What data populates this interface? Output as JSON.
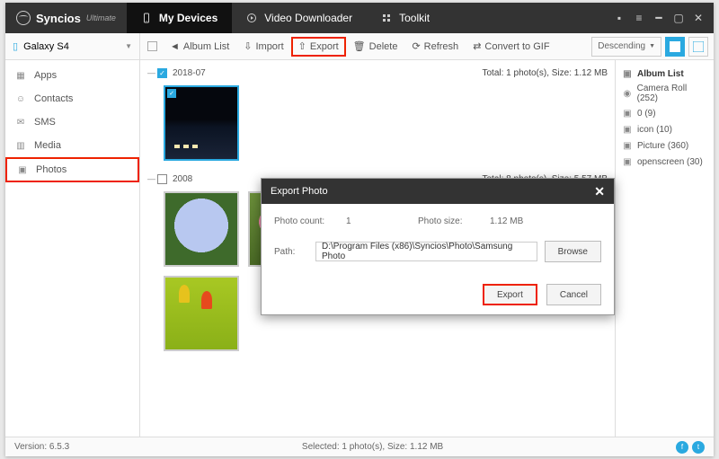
{
  "app": {
    "name": "Syncios",
    "edition": "Ultimate"
  },
  "top_tabs": [
    {
      "id": "devices",
      "label": "My Devices"
    },
    {
      "id": "video",
      "label": "Video Downloader"
    },
    {
      "id": "toolkit",
      "label": "Toolkit"
    }
  ],
  "device": {
    "name": "Galaxy S4"
  },
  "toolbar": {
    "album_list": "Album List",
    "import": "Import",
    "export": "Export",
    "delete": "Delete",
    "refresh": "Refresh",
    "convert": "Convert to GIF",
    "sort_label": "Descending"
  },
  "sidebar": [
    {
      "id": "apps",
      "label": "Apps"
    },
    {
      "id": "contacts",
      "label": "Contacts"
    },
    {
      "id": "sms",
      "label": "SMS"
    },
    {
      "id": "media",
      "label": "Media"
    },
    {
      "id": "photos",
      "label": "Photos"
    }
  ],
  "groups": [
    {
      "date": "2018-07",
      "checked": true,
      "summary": "Total: 1 photo(s), Size: 1.12 MB",
      "thumbs": [
        {
          "kind": "night",
          "selected": true
        }
      ]
    },
    {
      "date": "2008",
      "checked": false,
      "summary": "Total: 8 photo(s), Size: 5.57 MB",
      "thumbs": [
        {
          "kind": "flower"
        },
        {
          "kind": "cosmos"
        },
        {
          "kind": "kite"
        },
        {
          "kind": "koala"
        },
        {
          "kind": "jelly"
        },
        {
          "kind": "tulip"
        }
      ]
    }
  ],
  "albums": {
    "header": "Album List",
    "items": [
      {
        "label": "Camera Roll (252)"
      },
      {
        "label": "0 (9)"
      },
      {
        "label": "icon (10)"
      },
      {
        "label": "Picture (360)"
      },
      {
        "label": "openscreen (30)"
      }
    ]
  },
  "modal": {
    "title": "Export Photo",
    "count_label": "Photo count:",
    "count_val": "1",
    "size_label": "Photo size:",
    "size_val": "1.12 MB",
    "path_label": "Path:",
    "path_val": "D:\\Program Files (x86)\\Syncios\\Photo\\Samsung Photo",
    "browse": "Browse",
    "export": "Export",
    "cancel": "Cancel"
  },
  "status": {
    "version": "Version: 6.5.3",
    "selection": "Selected: 1 photo(s), Size: 1.12 MB"
  }
}
